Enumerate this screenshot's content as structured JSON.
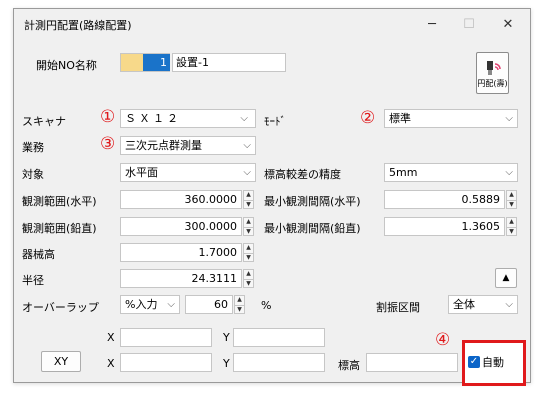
{
  "window": {
    "title": "計測円配置(路線配置)",
    "min_icon": "minimize-icon",
    "max_icon": "maximize-icon",
    "close_icon": "close-icon"
  },
  "start": {
    "label": "開始NO名称",
    "number": "1",
    "name": "設置-1"
  },
  "circle_button": {
    "label": "円配(壽)",
    "icon": "circle-placement-icon"
  },
  "markers": {
    "m1": "①",
    "m2": "②",
    "m3": "③",
    "m4": "④"
  },
  "scanner": {
    "label": "スキャナ",
    "value": "ＳＸ１２"
  },
  "mode": {
    "label": "ﾓｰﾄﾞ",
    "value": "標準"
  },
  "work": {
    "label": "業務",
    "value": "三次元点群測量"
  },
  "target": {
    "label": "対象",
    "value": "水平面"
  },
  "elev_precision": {
    "label": "標高較差の精度",
    "value": "5mm"
  },
  "range_h": {
    "label": "観測範囲(水平)",
    "value": "360.0000"
  },
  "min_int_h": {
    "label": "最小観測間隔(水平)",
    "value": "0.5889"
  },
  "range_v": {
    "label": "観測範囲(鉛直)",
    "value": "300.0000"
  },
  "min_int_v": {
    "label": "最小観測間隔(鉛直)",
    "value": "1.3605"
  },
  "instrument_height": {
    "label": "器械高",
    "value": "1.7000"
  },
  "radius": {
    "label": "半径",
    "value": "24.3111"
  },
  "overlap": {
    "label": "オーバーラップ",
    "mode": "%入力",
    "value": "60",
    "unit": "%"
  },
  "interval": {
    "label": "割振区間",
    "value": "全体"
  },
  "coords": {
    "x_label": "X",
    "y_label": "Y",
    "elev_label": "標高",
    "xy_button": "XY"
  },
  "auto": {
    "label": "自動",
    "checked": true
  },
  "colors": {
    "highlight": "#e0191b",
    "accent": "#0a64c8"
  }
}
